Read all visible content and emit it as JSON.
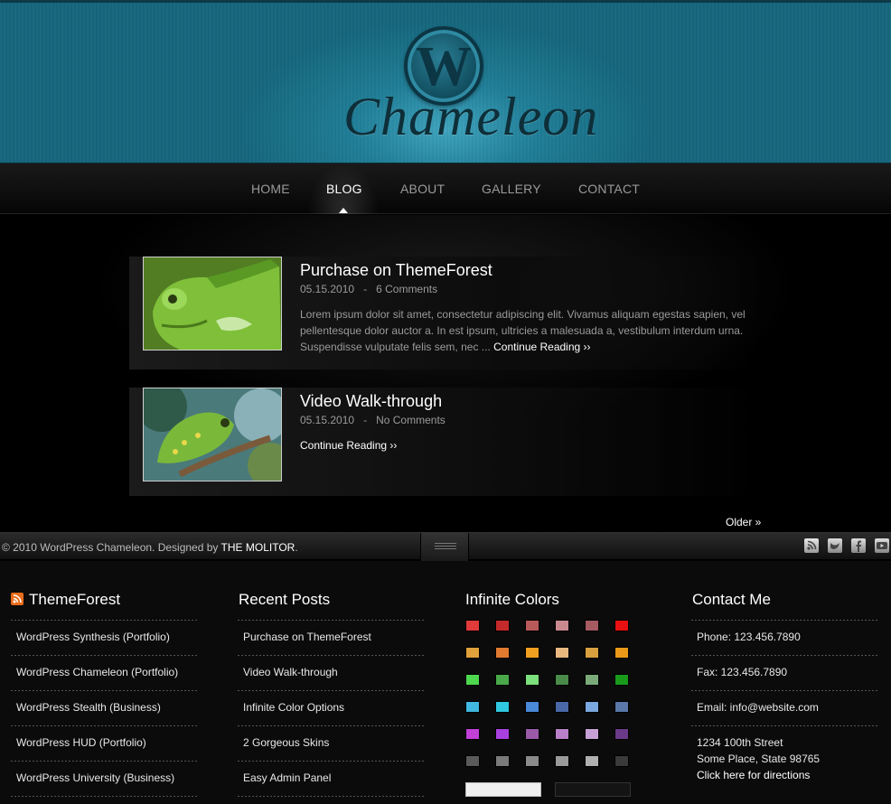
{
  "header": {
    "logo_text": "Chameleon",
    "logo_glyph": "W"
  },
  "nav": {
    "items": [
      {
        "label": "HOME",
        "active": false
      },
      {
        "label": "BLOG",
        "active": true
      },
      {
        "label": "ABOUT",
        "active": false
      },
      {
        "label": "GALLERY",
        "active": false
      },
      {
        "label": "CONTACT",
        "active": false
      }
    ]
  },
  "posts": [
    {
      "title": "Purchase on ThemeForest",
      "date": "05.15.2010",
      "comments": "6 Comments",
      "excerpt": "Lorem ipsum dolor sit amet, consectetur adipiscing elit. Vivamus aliquam egestas sapien, vel pellentesque dolor auctor a. In est ipsum, ultricies a malesuada a, vestibulum interdum urna. Suspendisse vulputate felis sem, nec ...",
      "more": "Continue Reading ››"
    },
    {
      "title": "Video Walk-through",
      "date": "05.15.2010",
      "comments": "No Comments",
      "more": "Continue Reading ››"
    }
  ],
  "pagination": {
    "older": "Older »"
  },
  "footer": {
    "copyright": "© 2010 WordPress Chameleon. Designed by",
    "author": "THE MOLITOR",
    "period": ".",
    "social_icons": [
      "rss-icon",
      "twitter-icon",
      "facebook-icon",
      "youtube-icon"
    ]
  },
  "widgets": {
    "themeforest": {
      "title": "ThemeForest",
      "items": [
        "WordPress Synthesis (Portfolio)",
        "WordPress Chameleon (Portfolio)",
        "WordPress Stealth (Business)",
        "WordPress HUD (Portfolio)",
        "WordPress University (Business)"
      ]
    },
    "recent": {
      "title": "Recent Posts",
      "items": [
        "Purchase on ThemeForest",
        "Video Walk-through",
        "Infinite Color Options",
        "2 Gorgeous Skins",
        "Easy Admin Panel"
      ]
    },
    "colors": {
      "title": "Infinite Colors",
      "swatches": [
        [
          "#e03a3a",
          "#c52a2a",
          "#b85a5a",
          "#c98a8f",
          "#a65a62",
          "#e81010"
        ],
        [
          "#e0a03a",
          "#e07a30",
          "#f0a020",
          "#e8b880",
          "#d9a040",
          "#e89a18"
        ],
        [
          "#4ed84e",
          "#4aa84a",
          "#7ce07c",
          "#4a8a4a",
          "#7aaa7a",
          "#1a9a1a"
        ],
        [
          "#40b8e0",
          "#30c8e0",
          "#4a88d8",
          "#4a68a8",
          "#7aa8e0",
          "#5a78a8"
        ],
        [
          "#c040d8",
          "#a840e0",
          "#9a5aa8",
          "#b880c8",
          "#c8a0d8",
          "#6a3a88"
        ],
        [
          "#5a5a5a",
          "#7a7a7a",
          "#8a8a8a",
          "#9a9a9a",
          "#b0b0b0",
          "#3a3a3a"
        ]
      ],
      "skins": [
        "#f0f0f0",
        "#141414"
      ]
    },
    "contact": {
      "title": "Contact Me",
      "phone": "Phone: 123.456.7890",
      "fax": "Fax: 123.456.7890",
      "email": "Email: info@website.com",
      "street": "1234 100th Street",
      "city": "Some Place, State 98765",
      "directions": "Click here for directions"
    }
  }
}
